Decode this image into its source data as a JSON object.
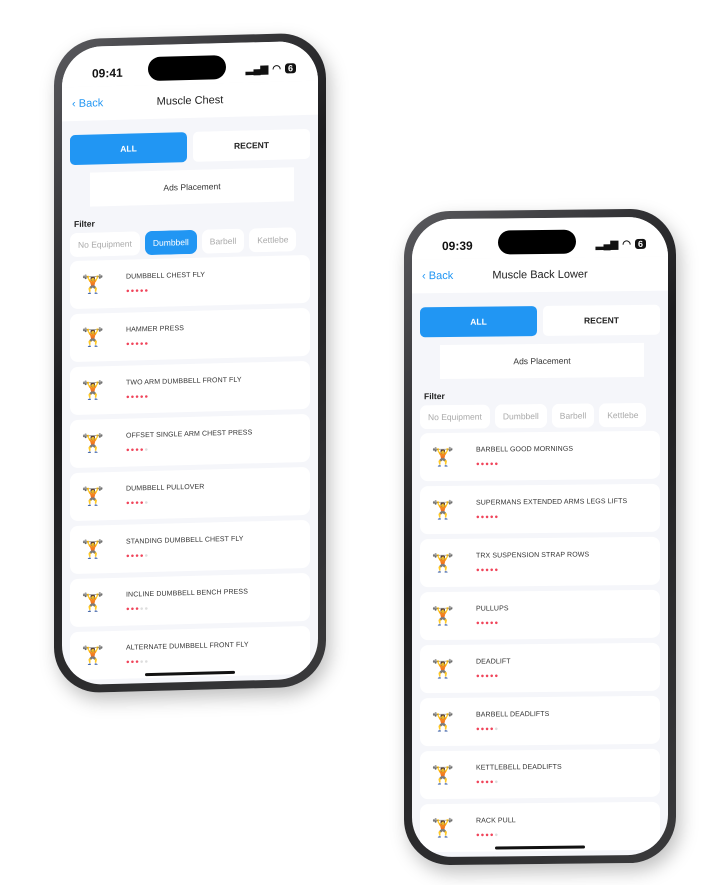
{
  "colors": {
    "accent": "#2196f3",
    "rating": "#f0445a"
  },
  "phones": [
    {
      "time": "09:41",
      "battery": "6",
      "back": "Back",
      "title": "Muscle Chest",
      "tabs": {
        "all": "ALL",
        "recent": "RECENT",
        "active": "all"
      },
      "ads": "Ads Placement",
      "filter_label": "Filter",
      "filters": [
        "No Equipment",
        "Dumbbell",
        "Barbell",
        "Kettlebe"
      ],
      "selected_filter": "Dumbbell",
      "items": [
        {
          "name": "DUMBBELL CHEST FLY",
          "rating": 5
        },
        {
          "name": "HAMMER PRESS",
          "rating": 5
        },
        {
          "name": "TWO ARM DUMBBELL FRONT FLY",
          "rating": 5
        },
        {
          "name": "OFFSET SINGLE ARM CHEST PRESS",
          "rating": 4
        },
        {
          "name": "DUMBBELL PULLOVER",
          "rating": 4
        },
        {
          "name": "STANDING DUMBBELL CHEST FLY",
          "rating": 4
        },
        {
          "name": "INCLINE DUMBBELL BENCH PRESS",
          "rating": 3
        },
        {
          "name": "ALTERNATE DUMBBELL FRONT FLY",
          "rating": 3
        }
      ]
    },
    {
      "time": "09:39",
      "battery": "6",
      "back": "Back",
      "title": "Muscle Back Lower",
      "tabs": {
        "all": "ALL",
        "recent": "RECENT",
        "active": "all"
      },
      "ads": "Ads Placement",
      "filter_label": "Filter",
      "filters": [
        "No Equipment",
        "Dumbbell",
        "Barbell",
        "Kettlebe"
      ],
      "selected_filter": null,
      "items": [
        {
          "name": "BARBELL GOOD MORNINGS",
          "rating": 5
        },
        {
          "name": "SUPERMANS EXTENDED ARMS LEGS LIFTS",
          "rating": 5
        },
        {
          "name": "TRX SUSPENSION STRAP ROWS",
          "rating": 5
        },
        {
          "name": "PULLUPS",
          "rating": 5
        },
        {
          "name": "DEADLIFT",
          "rating": 5
        },
        {
          "name": "BARBELL DEADLIFTS",
          "rating": 4
        },
        {
          "name": "KETTLEBELL DEADLIFTS",
          "rating": 4
        },
        {
          "name": "RACK PULL",
          "rating": 4
        }
      ]
    }
  ]
}
